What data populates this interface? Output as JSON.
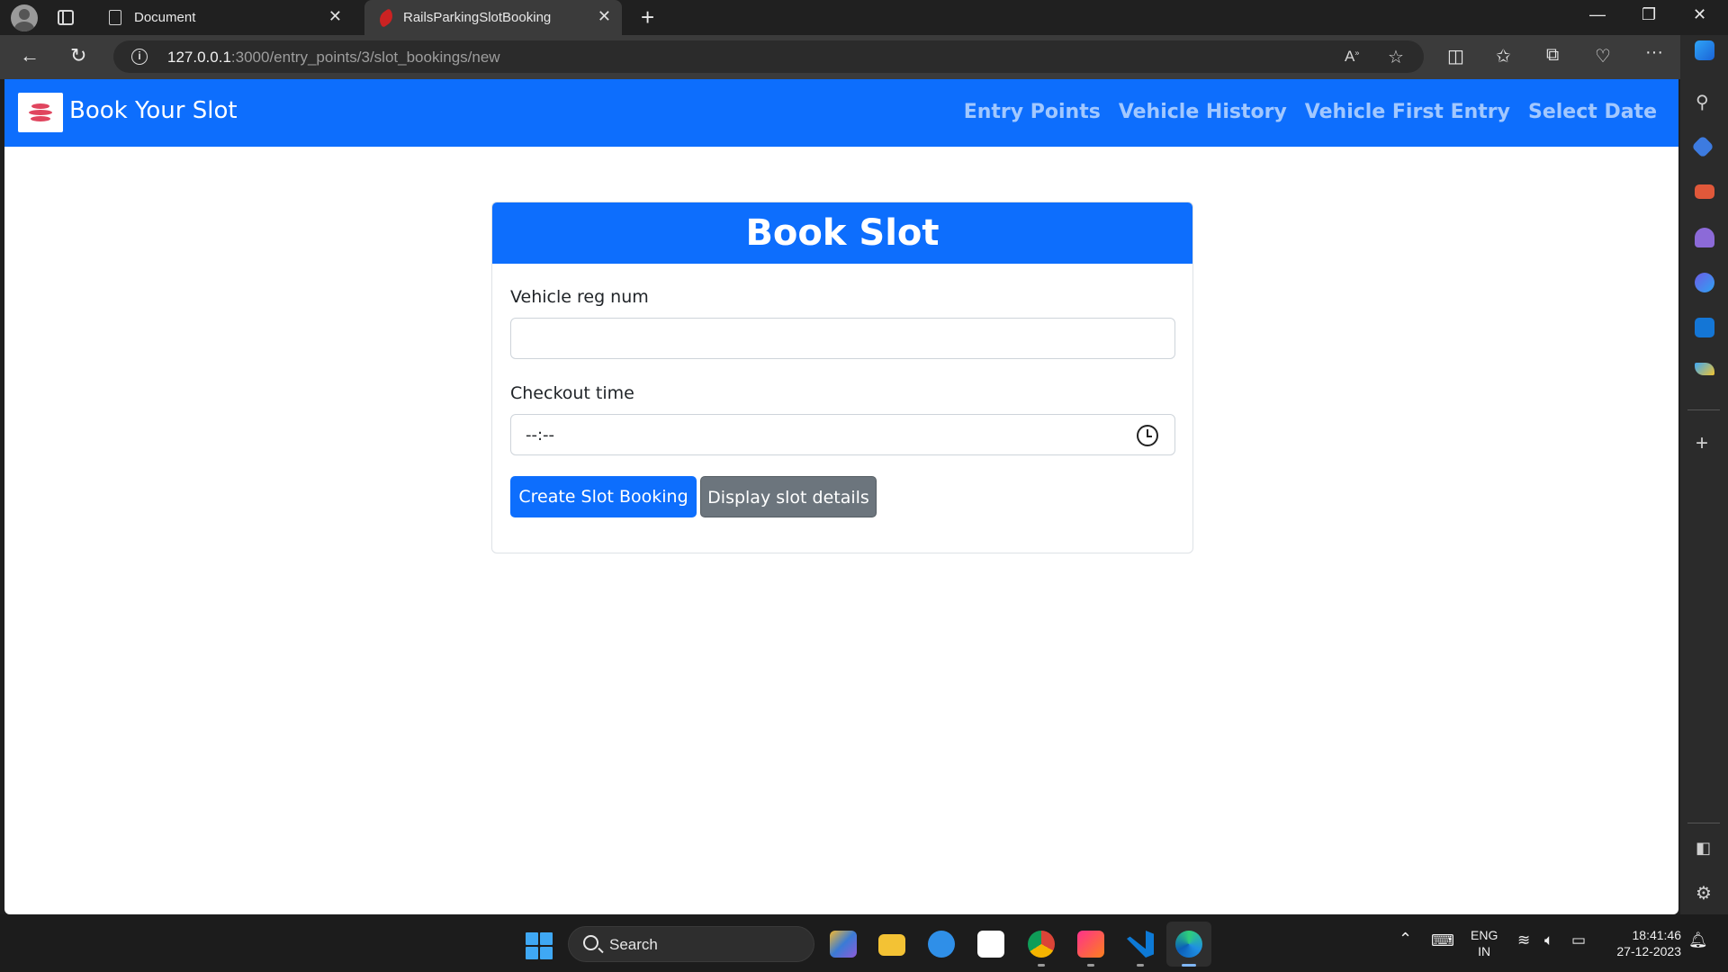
{
  "browser": {
    "tabs": [
      {
        "title": "Document"
      },
      {
        "title": "RailsParkingSlotBooking"
      }
    ],
    "url_host": "127.0.0.1",
    "url_rest": ":3000/entry_points/3/slot_bookings/new"
  },
  "navbar": {
    "brand": "Book Your Slot",
    "links": [
      "Entry Points",
      "Vehicle History",
      "Vehicle First Entry",
      "Select Date"
    ]
  },
  "form": {
    "title": "Book Slot",
    "vehicle_label": "Vehicle reg num",
    "vehicle_value": "",
    "checkout_label": "Checkout time",
    "checkout_value": "--:--",
    "submit_label": "Create Slot Booking",
    "display_label": "Display slot details"
  },
  "taskbar": {
    "search_label": "Search",
    "language": "ENG",
    "region": "IN",
    "time": "18:41:46",
    "date": "27-12-2023"
  },
  "colors": {
    "primary": "#0d6efd",
    "secondary": "#6c757d"
  }
}
